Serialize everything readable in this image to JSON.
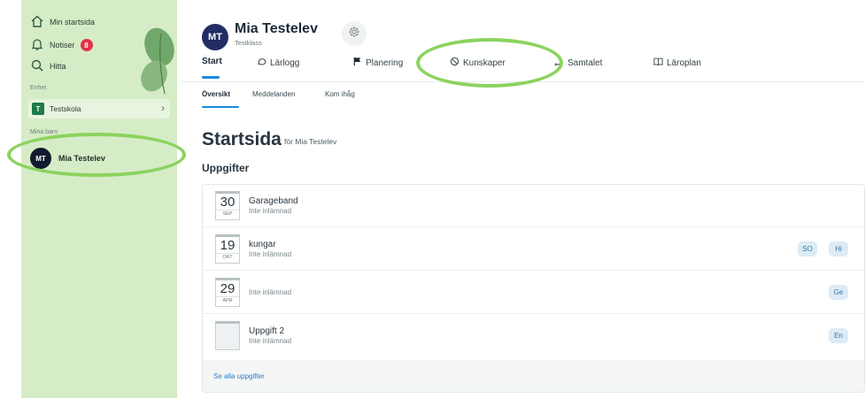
{
  "sidebar": {
    "home": {
      "label": "Min startsida",
      "icon": "home-icon"
    },
    "notifications": {
      "label": "Notiser",
      "count": "8",
      "icon": "bell-icon"
    },
    "search": {
      "label": "Hitta",
      "icon": "search-icon"
    },
    "unit_section_label": "Enhet",
    "school": {
      "label": "Testskola",
      "initial": "T"
    },
    "children_section_label": "Mina barn",
    "student": {
      "name": "Mia Testelev",
      "initials": "MT"
    }
  },
  "profile": {
    "initials": "MT",
    "name": "Mia Testelev",
    "class": "Testklass"
  },
  "tabs": [
    {
      "label": "Start",
      "icon": ""
    },
    {
      "label": "Lärlogg",
      "icon": "speech-bubble-icon"
    },
    {
      "label": "Planering",
      "icon": "flag-icon"
    },
    {
      "label": "Kunskaper",
      "icon": "ban-circle-icon"
    },
    {
      "label": "Samtalet",
      "icon": "chat-icon"
    },
    {
      "label": "Läroplan",
      "icon": "book-icon"
    }
  ],
  "subtabs": [
    "Översikt",
    "Meddelanden",
    "Kom ihåg"
  ],
  "page": {
    "title": "Startsida",
    "subtitle": "för Mia Testelev",
    "section_title": "Uppgifter"
  },
  "assignments": [
    {
      "day": "30",
      "month": "SEP",
      "title": "Garageband",
      "status": "Inte inlämnad",
      "tags": []
    },
    {
      "day": "19",
      "month": "OKT",
      "title": "kungar",
      "status": "Inte inlämnad",
      "tags": [
        "SO",
        "Hi"
      ]
    },
    {
      "day": "29",
      "month": "APR",
      "title": "",
      "status": "Inte inlämnad",
      "tags": [
        "Ge"
      ]
    },
    {
      "day": "",
      "month": "",
      "title": "Uppgift 2",
      "status": "Inte inlämnad",
      "tags": [
        "En"
      ]
    }
  ],
  "see_all_label": "Se alla uppgifter",
  "colors": {
    "sidebar_bg": "#d6ecc7",
    "accent_blue": "#1a8be0",
    "highlight_green": "#8bd35e",
    "badge_red": "#e0334a",
    "tag_bg": "#dcebf6"
  }
}
